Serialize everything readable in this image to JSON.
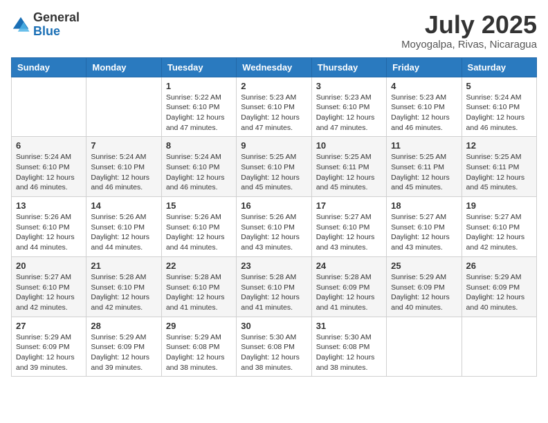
{
  "logo": {
    "general": "General",
    "blue": "Blue"
  },
  "title": "July 2025",
  "location": "Moyogalpa, Rivas, Nicaragua",
  "days_of_week": [
    "Sunday",
    "Monday",
    "Tuesday",
    "Wednesday",
    "Thursday",
    "Friday",
    "Saturday"
  ],
  "weeks": [
    [
      null,
      null,
      {
        "day": 1,
        "sunrise": "5:22 AM",
        "sunset": "6:10 PM",
        "daylight": "12 hours and 47 minutes."
      },
      {
        "day": 2,
        "sunrise": "5:23 AM",
        "sunset": "6:10 PM",
        "daylight": "12 hours and 47 minutes."
      },
      {
        "day": 3,
        "sunrise": "5:23 AM",
        "sunset": "6:10 PM",
        "daylight": "12 hours and 47 minutes."
      },
      {
        "day": 4,
        "sunrise": "5:23 AM",
        "sunset": "6:10 PM",
        "daylight": "12 hours and 46 minutes."
      },
      {
        "day": 5,
        "sunrise": "5:24 AM",
        "sunset": "6:10 PM",
        "daylight": "12 hours and 46 minutes."
      }
    ],
    [
      {
        "day": 6,
        "sunrise": "5:24 AM",
        "sunset": "6:10 PM",
        "daylight": "12 hours and 46 minutes."
      },
      {
        "day": 7,
        "sunrise": "5:24 AM",
        "sunset": "6:10 PM",
        "daylight": "12 hours and 46 minutes."
      },
      {
        "day": 8,
        "sunrise": "5:24 AM",
        "sunset": "6:10 PM",
        "daylight": "12 hours and 46 minutes."
      },
      {
        "day": 9,
        "sunrise": "5:25 AM",
        "sunset": "6:10 PM",
        "daylight": "12 hours and 45 minutes."
      },
      {
        "day": 10,
        "sunrise": "5:25 AM",
        "sunset": "6:11 PM",
        "daylight": "12 hours and 45 minutes."
      },
      {
        "day": 11,
        "sunrise": "5:25 AM",
        "sunset": "6:11 PM",
        "daylight": "12 hours and 45 minutes."
      },
      {
        "day": 12,
        "sunrise": "5:25 AM",
        "sunset": "6:11 PM",
        "daylight": "12 hours and 45 minutes."
      }
    ],
    [
      {
        "day": 13,
        "sunrise": "5:26 AM",
        "sunset": "6:10 PM",
        "daylight": "12 hours and 44 minutes."
      },
      {
        "day": 14,
        "sunrise": "5:26 AM",
        "sunset": "6:10 PM",
        "daylight": "12 hours and 44 minutes."
      },
      {
        "day": 15,
        "sunrise": "5:26 AM",
        "sunset": "6:10 PM",
        "daylight": "12 hours and 44 minutes."
      },
      {
        "day": 16,
        "sunrise": "5:26 AM",
        "sunset": "6:10 PM",
        "daylight": "12 hours and 43 minutes."
      },
      {
        "day": 17,
        "sunrise": "5:27 AM",
        "sunset": "6:10 PM",
        "daylight": "12 hours and 43 minutes."
      },
      {
        "day": 18,
        "sunrise": "5:27 AM",
        "sunset": "6:10 PM",
        "daylight": "12 hours and 43 minutes."
      },
      {
        "day": 19,
        "sunrise": "5:27 AM",
        "sunset": "6:10 PM",
        "daylight": "12 hours and 42 minutes."
      }
    ],
    [
      {
        "day": 20,
        "sunrise": "5:27 AM",
        "sunset": "6:10 PM",
        "daylight": "12 hours and 42 minutes."
      },
      {
        "day": 21,
        "sunrise": "5:28 AM",
        "sunset": "6:10 PM",
        "daylight": "12 hours and 42 minutes."
      },
      {
        "day": 22,
        "sunrise": "5:28 AM",
        "sunset": "6:10 PM",
        "daylight": "12 hours and 41 minutes."
      },
      {
        "day": 23,
        "sunrise": "5:28 AM",
        "sunset": "6:10 PM",
        "daylight": "12 hours and 41 minutes."
      },
      {
        "day": 24,
        "sunrise": "5:28 AM",
        "sunset": "6:09 PM",
        "daylight": "12 hours and 41 minutes."
      },
      {
        "day": 25,
        "sunrise": "5:29 AM",
        "sunset": "6:09 PM",
        "daylight": "12 hours and 40 minutes."
      },
      {
        "day": 26,
        "sunrise": "5:29 AM",
        "sunset": "6:09 PM",
        "daylight": "12 hours and 40 minutes."
      }
    ],
    [
      {
        "day": 27,
        "sunrise": "5:29 AM",
        "sunset": "6:09 PM",
        "daylight": "12 hours and 39 minutes."
      },
      {
        "day": 28,
        "sunrise": "5:29 AM",
        "sunset": "6:09 PM",
        "daylight": "12 hours and 39 minutes."
      },
      {
        "day": 29,
        "sunrise": "5:29 AM",
        "sunset": "6:08 PM",
        "daylight": "12 hours and 38 minutes."
      },
      {
        "day": 30,
        "sunrise": "5:30 AM",
        "sunset": "6:08 PM",
        "daylight": "12 hours and 38 minutes."
      },
      {
        "day": 31,
        "sunrise": "5:30 AM",
        "sunset": "6:08 PM",
        "daylight": "12 hours and 38 minutes."
      },
      null,
      null
    ]
  ]
}
